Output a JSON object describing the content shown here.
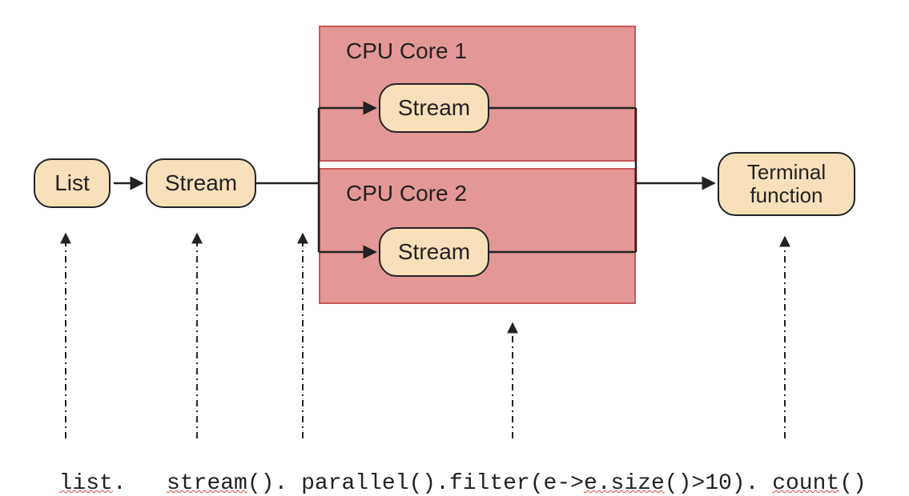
{
  "nodes": {
    "list": "List",
    "stream": "Stream",
    "stream1": "Stream",
    "stream2": "Stream",
    "terminal": "Terminal function"
  },
  "cores": {
    "core1": "CPU Core 1",
    "core2": "CPU Core 2"
  },
  "code": {
    "t1": "list",
    "t2": ". ",
    "t3": "stream",
    "t4": "(). parallel().filter(e->",
    "t5": "e.size",
    "t6": "()>10). ",
    "t7": "count",
    "t8": "()"
  }
}
